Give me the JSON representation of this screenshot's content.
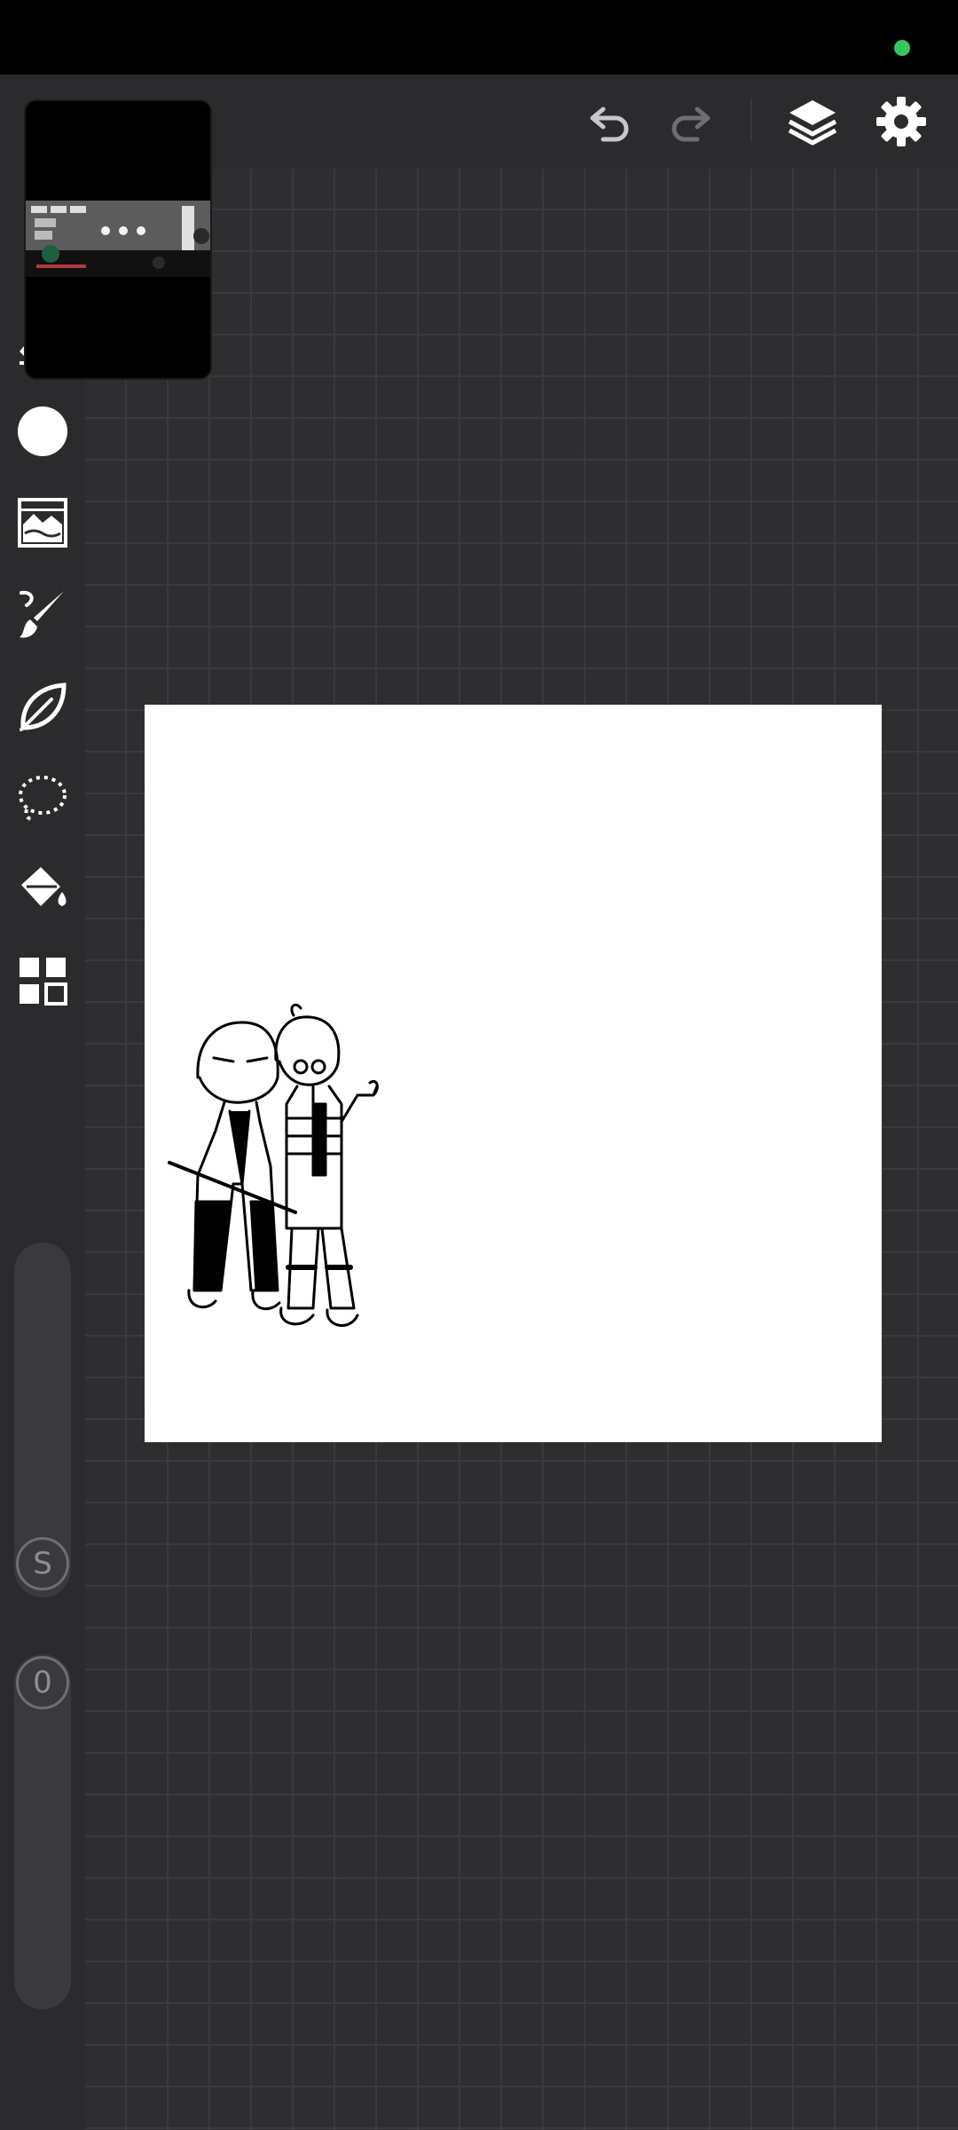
{
  "status_bar": {
    "indicator_color": "#34c759"
  },
  "top_toolbar": {
    "buttons": [
      {
        "name": "undo",
        "icon": "undo-icon"
      },
      {
        "name": "redo",
        "icon": "redo-icon"
      },
      {
        "name": "layers",
        "icon": "layers-icon"
      },
      {
        "name": "settings",
        "icon": "gear-icon"
      }
    ]
  },
  "left_toolbar": {
    "tools": [
      {
        "name": "eraser",
        "icon": "eraser-icon"
      },
      {
        "name": "color",
        "icon": "color-circle-icon",
        "color": "#ffffff"
      },
      {
        "name": "image",
        "icon": "image-icon"
      },
      {
        "name": "brush",
        "icon": "brush-icon"
      },
      {
        "name": "smudge",
        "icon": "leaf-icon"
      },
      {
        "name": "lasso",
        "icon": "lasso-icon"
      },
      {
        "name": "fill",
        "icon": "paint-bucket-icon"
      },
      {
        "name": "more",
        "icon": "grid-icon"
      }
    ],
    "size_slider": {
      "label": "S"
    },
    "opacity_slider": {
      "label": "0"
    }
  },
  "colors": {
    "accent": "#1e88e5",
    "panel": "#2b2b2e",
    "icon": "#ffffff",
    "disabled_icon": "#8e8e93"
  }
}
